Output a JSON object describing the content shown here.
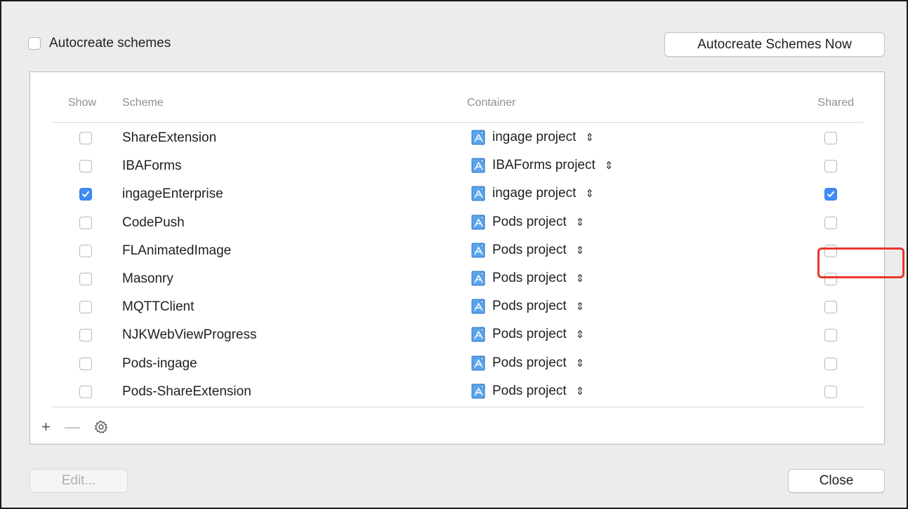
{
  "autocreate_checkbox": {
    "label": "Autocreate schemes",
    "checked": false
  },
  "autocreate_now_button": "Autocreate Schemes Now",
  "columns": {
    "show": "Show",
    "scheme": "Scheme",
    "container": "Container",
    "shared": "Shared"
  },
  "schemes": [
    {
      "name": "ShareExtension",
      "container": "ingage project",
      "show": false,
      "shared": false
    },
    {
      "name": "IBAForms",
      "container": "IBAForms project",
      "show": false,
      "shared": false
    },
    {
      "name": "ingageEnterprise",
      "container": "ingage project",
      "show": true,
      "shared": true
    },
    {
      "name": "CodePush",
      "container": "Pods project",
      "show": false,
      "shared": false
    },
    {
      "name": "FLAnimatedImage",
      "container": "Pods project",
      "show": false,
      "shared": false
    },
    {
      "name": "Masonry",
      "container": "Pods project",
      "show": false,
      "shared": false
    },
    {
      "name": "MQTTClient",
      "container": "Pods project",
      "show": false,
      "shared": false
    },
    {
      "name": "NJKWebViewProgress",
      "container": "Pods project",
      "show": false,
      "shared": false
    },
    {
      "name": "Pods-ingage",
      "container": "Pods project",
      "show": false,
      "shared": false
    },
    {
      "name": "Pods-ShareExtension",
      "container": "Pods project",
      "show": false,
      "shared": false
    }
  ],
  "toolbar": {
    "add": "+",
    "remove": "—",
    "gear_icon": "gear-icon"
  },
  "edit_button": "Edit...",
  "close_button": "Close",
  "colors": {
    "checked": "#3e8cf5",
    "highlight": "#e8372b"
  }
}
